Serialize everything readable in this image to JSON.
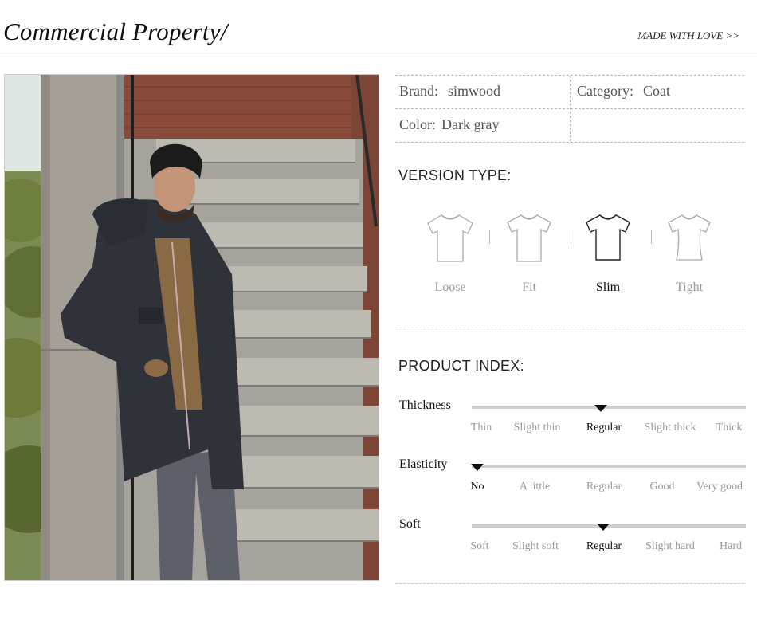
{
  "header": {
    "title": "Commercial Property/",
    "tagline": "MADE WITH LOVE >>"
  },
  "attributes": {
    "brand_key": "Brand:",
    "brand_value": "simwood",
    "category_key": "Category:",
    "category_value": "Coat",
    "color_key": "Color:",
    "color_value": "Dark gray"
  },
  "version_type": {
    "title": "VERSION TYPE:",
    "options": [
      {
        "label": "Loose",
        "active": false
      },
      {
        "label": "Fit",
        "active": false
      },
      {
        "label": "Slim",
        "active": true
      },
      {
        "label": "Tight",
        "active": false
      }
    ]
  },
  "product_index": {
    "title": "PRODUCT INDEX:",
    "metrics": [
      {
        "name": "Thickness",
        "labels": [
          "Thin",
          "Slight thin",
          "Regular",
          "Slight thick",
          "Thick"
        ],
        "selected": 2
      },
      {
        "name": "Elasticity",
        "labels": [
          "No",
          "A little",
          "Regular",
          "Good",
          "Very good"
        ],
        "selected": 0
      },
      {
        "name": "Soft",
        "labels": [
          "Soft",
          "Slight soft",
          "Regular",
          "Slight hard",
          "Hard"
        ],
        "selected": 2
      }
    ]
  },
  "colors": {
    "coat": "#2f3238",
    "brick": "#8a4a3a",
    "active": "#111111",
    "inactive": "#999999"
  }
}
